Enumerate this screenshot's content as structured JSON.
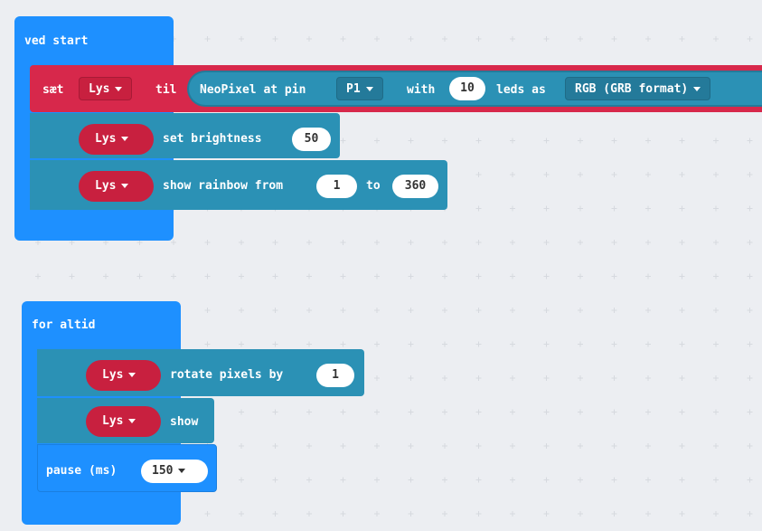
{
  "workspace": {
    "background": "#eceef2"
  },
  "colors": {
    "event": "#1e90ff",
    "statement": "#2b91b5",
    "variable": "#d7284b"
  },
  "on_start": {
    "label": "ved start",
    "set_block": {
      "set_word": "sæt",
      "variable": "Lys",
      "to_word": "til",
      "neopixel": {
        "prefix": "NeoPixel at pin",
        "pin": "P1",
        "with_word": "with",
        "led_count": "10",
        "leds_as": "leds as",
        "mode": "RGB (GRB format)"
      }
    },
    "brightness_block": {
      "variable": "Lys",
      "label": "set brightness",
      "value": "50"
    },
    "rainbow_block": {
      "variable": "Lys",
      "label": "show rainbow from",
      "from": "1",
      "to_word": "to",
      "to": "360"
    }
  },
  "forever": {
    "label": "for altid",
    "rotate_block": {
      "variable": "Lys",
      "label": "rotate pixels by",
      "value": "1"
    },
    "show_block": {
      "variable": "Lys",
      "label": "show"
    },
    "pause_block": {
      "label": "pause (ms)",
      "value": "150"
    }
  }
}
